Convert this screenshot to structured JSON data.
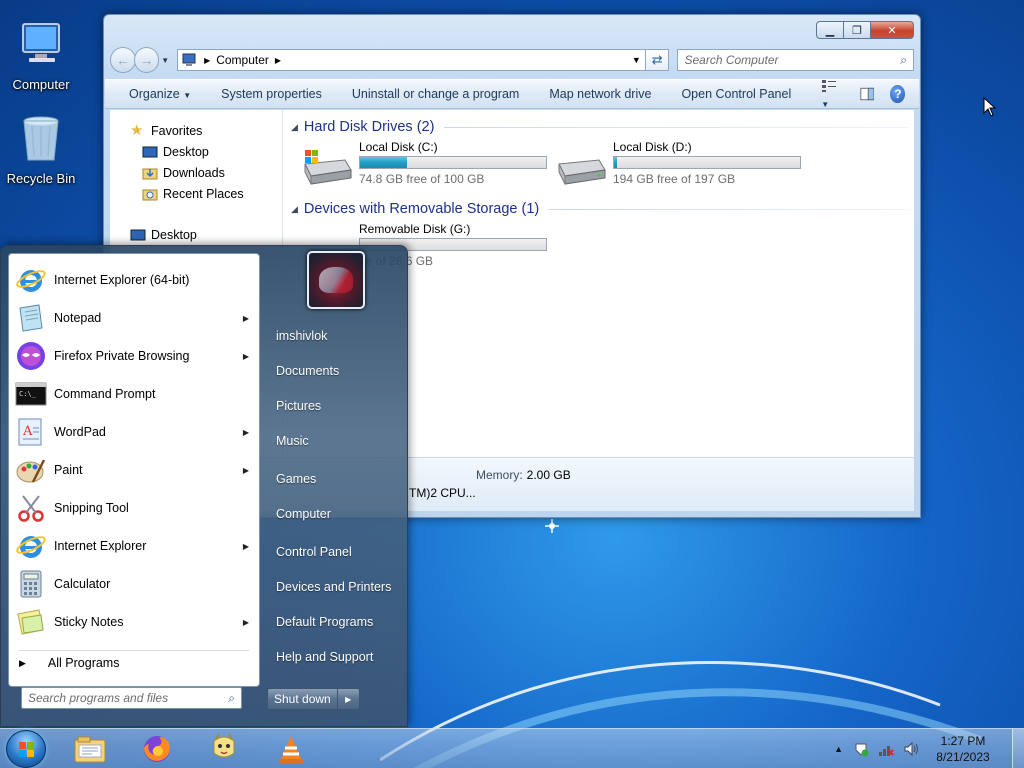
{
  "desktop": {
    "icons": [
      {
        "label": "Computer",
        "icon": "computer-icon"
      },
      {
        "label": "Recycle Bin",
        "icon": "recycle-bin-icon"
      }
    ]
  },
  "explorer": {
    "address": {
      "root_icon": "computer-small-icon",
      "crumb": "Computer"
    },
    "search": {
      "placeholder": "Search Computer"
    },
    "toolbar": {
      "organize": "Organize",
      "system_properties": "System properties",
      "uninstall": "Uninstall or change a program",
      "map_drive": "Map network drive",
      "control_panel": "Open Control Panel"
    },
    "nav_pane": {
      "favorites": "Favorites",
      "desktop": "Desktop",
      "downloads": "Downloads",
      "recent": "Recent Places",
      "desktop_root": "Desktop"
    },
    "groups": {
      "hdd": {
        "title": "Hard Disk Drives (2)",
        "drives": [
          {
            "name": "Local Disk (C:)",
            "free": "74.8 GB free of 100 GB",
            "used_fraction": 0.25
          },
          {
            "name": "Local Disk (D:)",
            "free": "194 GB free of 197 GB",
            "used_fraction": 0.015
          }
        ]
      },
      "removable": {
        "title": "Devices with Removable Storage (1)",
        "drives": [
          {
            "name": "Removable Disk (G:)",
            "free": "ee of 28.6 GB",
            "used_fraction": 0.0
          }
        ]
      }
    },
    "details": {
      "memory_label": "Memory:",
      "memory_value": "2.00 GB",
      "cpu": "TM)2 CPU..."
    }
  },
  "start_menu": {
    "programs": [
      {
        "label": "Internet Explorer (64-bit)",
        "icon": "internet-explorer-icon",
        "submenu": false
      },
      {
        "label": "Notepad",
        "icon": "notepad-icon",
        "submenu": true
      },
      {
        "label": "Firefox Private Browsing",
        "icon": "firefox-private-icon",
        "submenu": true
      },
      {
        "label": "Command Prompt",
        "icon": "command-prompt-icon",
        "submenu": false
      },
      {
        "label": "WordPad",
        "icon": "wordpad-icon",
        "submenu": true
      },
      {
        "label": "Paint",
        "icon": "paint-icon",
        "submenu": true
      },
      {
        "label": "Snipping Tool",
        "icon": "snipping-tool-icon",
        "submenu": false
      },
      {
        "label": "Internet Explorer",
        "icon": "internet-explorer-icon",
        "submenu": true
      },
      {
        "label": "Calculator",
        "icon": "calculator-icon",
        "submenu": false
      },
      {
        "label": "Sticky Notes",
        "icon": "sticky-notes-icon",
        "submenu": true
      }
    ],
    "all_programs": "All Programs",
    "search_placeholder": "Search programs and files",
    "right": {
      "user": "imshivlok",
      "documents": "Documents",
      "pictures": "Pictures",
      "music": "Music",
      "games": "Games",
      "computer": "Computer",
      "control_panel": "Control Panel",
      "devices": "Devices and Printers",
      "default_programs": "Default Programs",
      "help": "Help and Support"
    },
    "shutdown": "Shut down"
  },
  "taskbar": {
    "apps": [
      "windows-explorer-icon",
      "firefox-icon",
      "pidgin-icon",
      "vlc-icon"
    ],
    "clock": {
      "time": "1:27 PM",
      "date": "8/21/2023"
    }
  },
  "colors": {
    "accent": "#1e3287",
    "bar_fill": "#239ec5"
  }
}
